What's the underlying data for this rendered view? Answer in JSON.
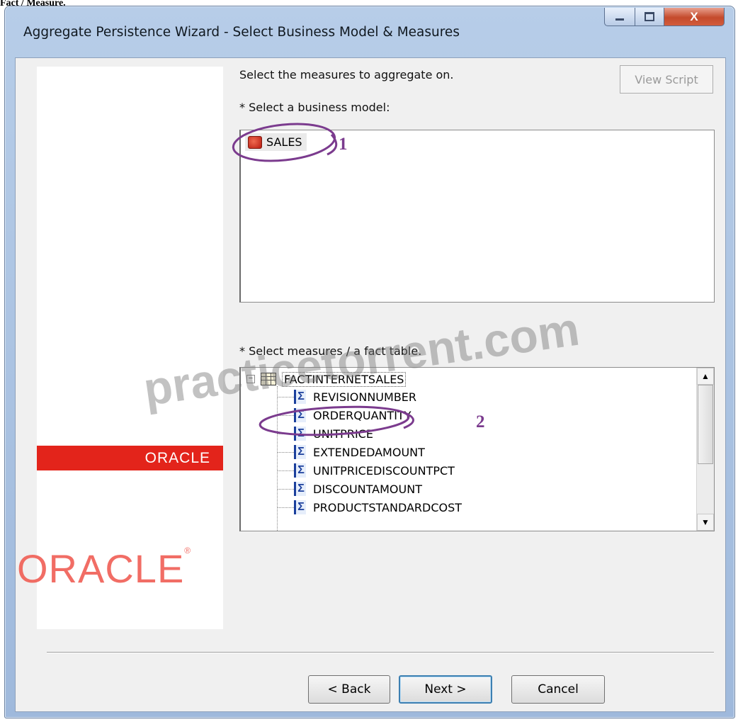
{
  "caption": "Fact / Measure.",
  "window": {
    "title": "Aggregate Persistence Wizard - Select Business Model & Measures",
    "controls": {
      "minimize": "minimize-icon",
      "maximize": "maximize-icon",
      "close": "X"
    }
  },
  "branding": {
    "bar_text": "ORACLE",
    "logo_text": "ORACLE",
    "logo_mark": "®"
  },
  "main": {
    "instruction": "Select the measures to aggregate on.",
    "view_script_label": "View Script",
    "business_model_label": "* Select a business model:",
    "business_models": [
      {
        "label": "SALES",
        "icon": "business-model-icon"
      }
    ],
    "measures_label": "* Select measures / a fact table.",
    "fact_table": {
      "label": "FACTINTERNETSALES",
      "expander": "−",
      "icon": "table-icon",
      "measures": [
        "REVISIONNUMBER",
        "ORDERQUANTITY",
        "UNITPRICE",
        "EXTENDEDAMOUNT",
        "UNITPRICEDISCOUNTPCT",
        "DISCOUNTAMOUNT",
        "PRODUCTSTANDARDCOST"
      ],
      "measure_icon": "Σ"
    }
  },
  "annotations": {
    "step1": "1",
    "step2": "2"
  },
  "watermark": "practicetorrent.com",
  "footer": {
    "back_label": "< Back",
    "next_label": "Next >",
    "cancel_label": "Cancel"
  },
  "colors": {
    "oracle_red": "#e3241b",
    "annotation_purple": "#7b3b8e",
    "sigma_blue": "#1b3f9c"
  }
}
